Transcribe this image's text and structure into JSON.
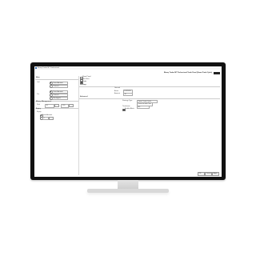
{
  "window": {
    "title": "Binary Trader MT Professional",
    "header_title": "Binary Trader MT Professional Trade Panel (Smart Trade Cycle)",
    "header_button": "Start"
  },
  "left": {
    "main_section": "Main",
    "call_label": "Call",
    "put_label": "Put",
    "risk_section": "Money Management",
    "risk_label": "Risk",
    "expiry_section": "Expiry",
    "expiry_label": "Expiry",
    "options": [
      "Fixed Amount",
      "Percent",
      "Martingale"
    ],
    "risk_value": "10",
    "expiry_value": "5",
    "lot_value": "1.00"
  },
  "right": {
    "check_top": "Show Panel",
    "check_sub": "Use Filter",
    "tab": "Trade",
    "section1": "Settings",
    "section1_sub": "General",
    "field1_label": "Asset",
    "field1_value": "EURUSD",
    "field2_label": "Amount",
    "field2_value": "10",
    "section2": "Advanced",
    "adv_label1": "Strategy Type",
    "adv_value1": "Smart Trade Cycle",
    "adv_value2": "Reversal after loss",
    "adv_label2": "Timeframe",
    "adv_value3": "M5",
    "adv_check": "Enable Alerts"
  },
  "footer": {
    "ok": "OK",
    "cancel": "Cancel",
    "apply": "Apply"
  },
  "colors": {
    "monitor": "#111111",
    "accent": "#3a6fb0"
  }
}
